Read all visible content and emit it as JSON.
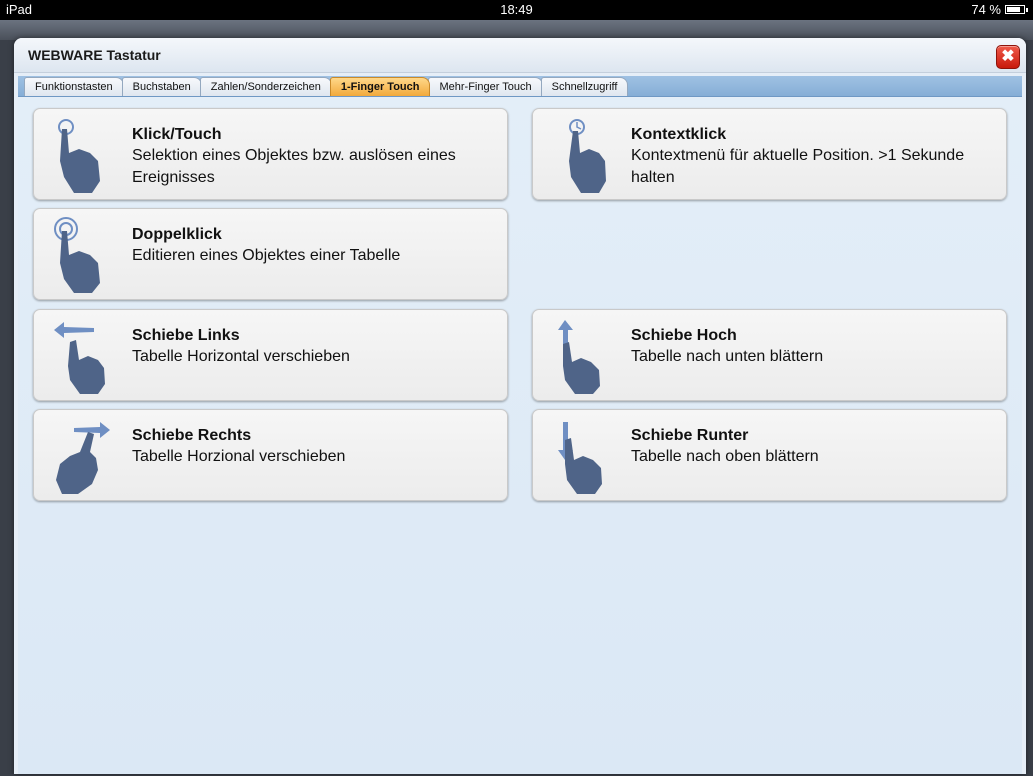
{
  "status_bar": {
    "device": "iPad",
    "time": "18:49",
    "battery": "74 %"
  },
  "dialog": {
    "title": "WEBWARE Tastatur",
    "close_symbol": "✖"
  },
  "tabs": [
    {
      "label": "Funktionstasten",
      "active": false
    },
    {
      "label": "Buchstaben",
      "active": false
    },
    {
      "label": "Zahlen/Sonderzeichen",
      "active": false
    },
    {
      "label": "1-Finger Touch",
      "active": true
    },
    {
      "label": "Mehr-Finger Touch",
      "active": false
    },
    {
      "label": "Schnellzugriff",
      "active": false
    }
  ],
  "gestures": [
    {
      "title": "Klick/Touch",
      "desc": "Selektion eines Objektes bzw. auslösen eines Ereignisses",
      "icon": "tap-gesture-icon"
    },
    {
      "title": "Kontextklick",
      "desc": "Kontextmenü für aktuelle Position. >1 Sekunde halten",
      "icon": "long-press-gesture-icon"
    },
    {
      "title": "Doppelklick",
      "desc": "Editieren eines Objektes einer Tabelle",
      "icon": "double-tap-gesture-icon"
    },
    {
      "title": "Schiebe Links",
      "desc": "Tabelle Horizontal verschieben",
      "icon": "swipe-left-gesture-icon"
    },
    {
      "title": "Schiebe Hoch",
      "desc": "Tabelle nach unten blättern",
      "icon": "swipe-up-gesture-icon"
    },
    {
      "title": "Schiebe Rechts",
      "desc": "Tabelle Horzional verschieben",
      "icon": "swipe-right-gesture-icon"
    },
    {
      "title": "Schiebe Runter",
      "desc": "Tabelle nach oben blättern",
      "icon": "swipe-down-gesture-icon"
    }
  ],
  "colors": {
    "active_tab": "#f2a93b",
    "tab_bar": "#86aed6",
    "icon_hand": "#4f6488",
    "icon_accent": "#6f8fc3"
  }
}
